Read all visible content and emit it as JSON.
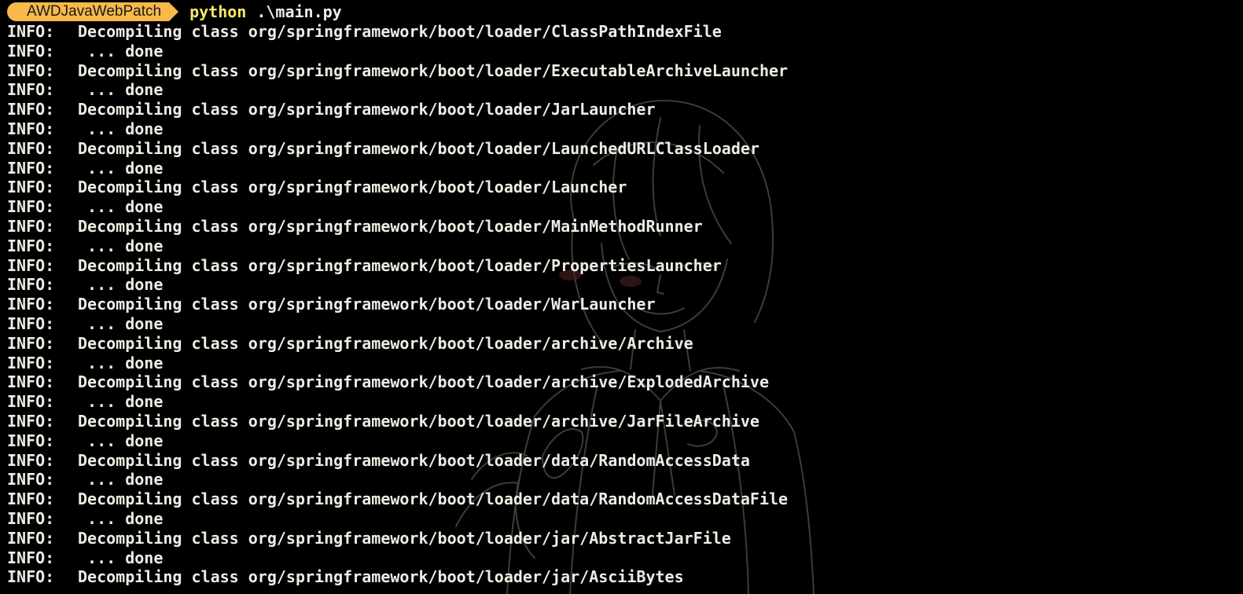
{
  "prompt": {
    "badge": "AWDJavaWebPatch",
    "command": "python",
    "argument": ".\\main.py"
  },
  "log": [
    {
      "level": "INFO:",
      "message": "Decompiling class org/springframework/boot/loader/ClassPathIndexFile"
    },
    {
      "level": "INFO:",
      "message": " ... done"
    },
    {
      "level": "INFO:",
      "message": "Decompiling class org/springframework/boot/loader/ExecutableArchiveLauncher"
    },
    {
      "level": "INFO:",
      "message": " ... done"
    },
    {
      "level": "INFO:",
      "message": "Decompiling class org/springframework/boot/loader/JarLauncher"
    },
    {
      "level": "INFO:",
      "message": " ... done"
    },
    {
      "level": "INFO:",
      "message": "Decompiling class org/springframework/boot/loader/LaunchedURLClassLoader"
    },
    {
      "level": "INFO:",
      "message": " ... done"
    },
    {
      "level": "INFO:",
      "message": "Decompiling class org/springframework/boot/loader/Launcher"
    },
    {
      "level": "INFO:",
      "message": " ... done"
    },
    {
      "level": "INFO:",
      "message": "Decompiling class org/springframework/boot/loader/MainMethodRunner"
    },
    {
      "level": "INFO:",
      "message": " ... done"
    },
    {
      "level": "INFO:",
      "message": "Decompiling class org/springframework/boot/loader/PropertiesLauncher"
    },
    {
      "level": "INFO:",
      "message": " ... done"
    },
    {
      "level": "INFO:",
      "message": "Decompiling class org/springframework/boot/loader/WarLauncher"
    },
    {
      "level": "INFO:",
      "message": " ... done"
    },
    {
      "level": "INFO:",
      "message": "Decompiling class org/springframework/boot/loader/archive/Archive"
    },
    {
      "level": "INFO:",
      "message": " ... done"
    },
    {
      "level": "INFO:",
      "message": "Decompiling class org/springframework/boot/loader/archive/ExplodedArchive"
    },
    {
      "level": "INFO:",
      "message": " ... done"
    },
    {
      "level": "INFO:",
      "message": "Decompiling class org/springframework/boot/loader/archive/JarFileArchive"
    },
    {
      "level": "INFO:",
      "message": " ... done"
    },
    {
      "level": "INFO:",
      "message": "Decompiling class org/springframework/boot/loader/data/RandomAccessData"
    },
    {
      "level": "INFO:",
      "message": " ... done"
    },
    {
      "level": "INFO:",
      "message": "Decompiling class org/springframework/boot/loader/data/RandomAccessDataFile"
    },
    {
      "level": "INFO:",
      "message": " ... done"
    },
    {
      "level": "INFO:",
      "message": "Decompiling class org/springframework/boot/loader/jar/AbstractJarFile"
    },
    {
      "level": "INFO:",
      "message": " ... done"
    },
    {
      "level": "INFO:",
      "message": "Decompiling class org/springframework/boot/loader/jar/AsciiBytes"
    }
  ],
  "colors": {
    "background": "#000000",
    "text": "#efece4",
    "badge": "#f6b94a",
    "command": "#f3ea6a"
  }
}
